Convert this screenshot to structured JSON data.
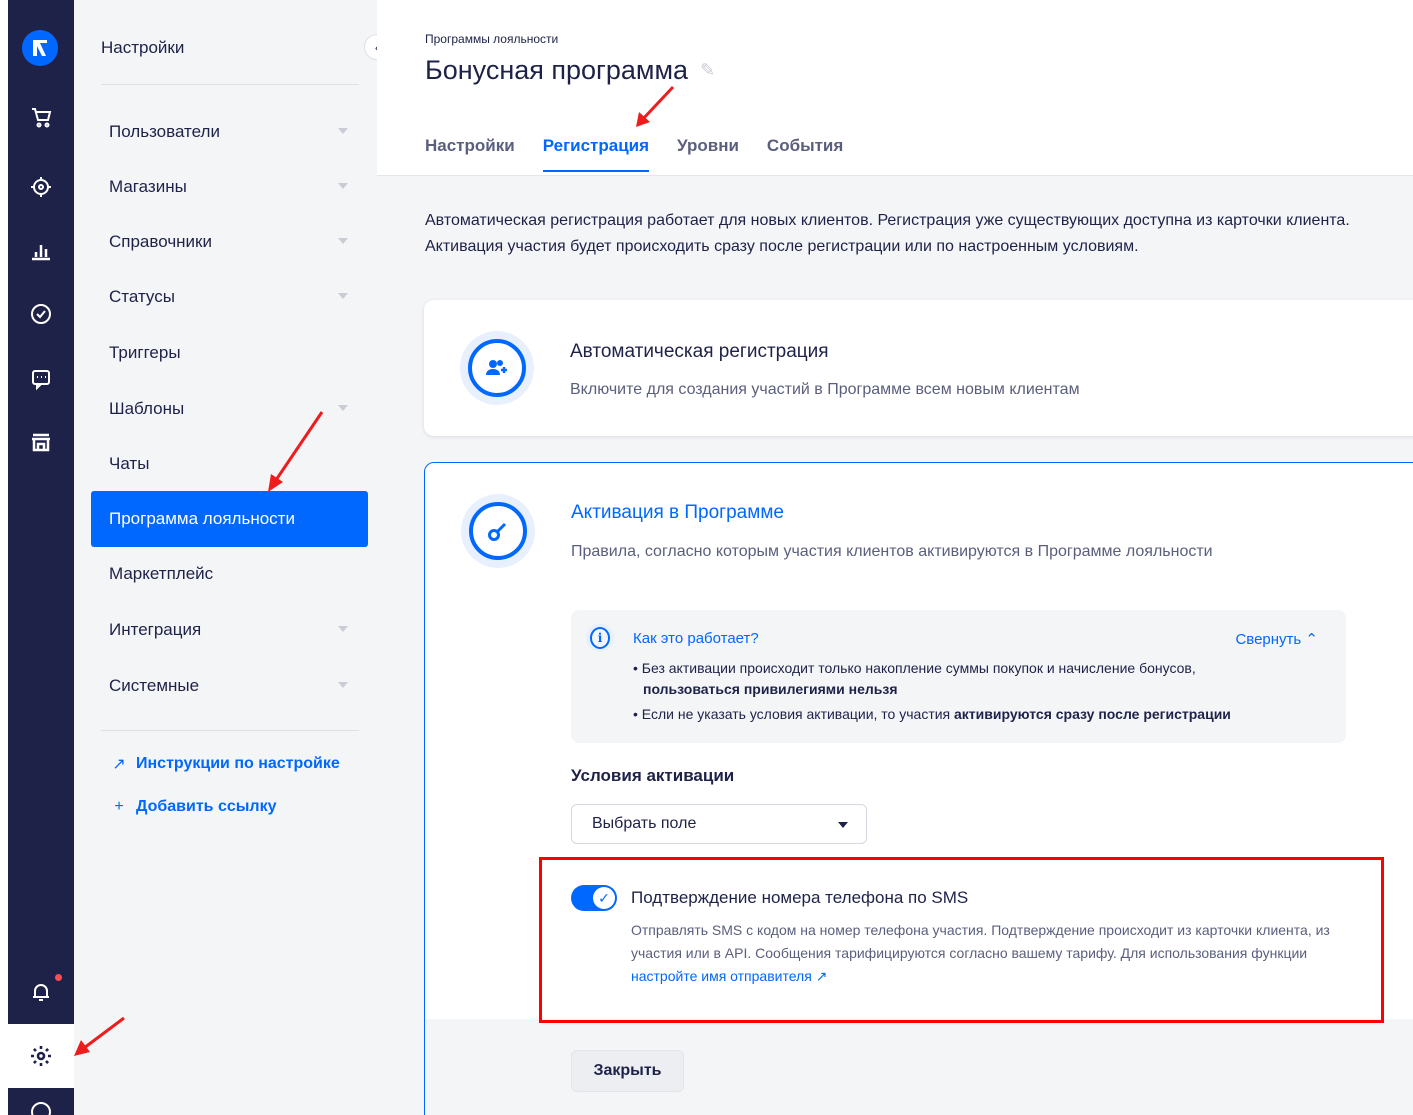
{
  "sidebar": {
    "title": "Настройки",
    "items": [
      {
        "label": "Пользователи",
        "caret": true
      },
      {
        "label": "Магазины",
        "caret": true
      },
      {
        "label": "Справочники",
        "caret": true
      },
      {
        "label": "Статусы",
        "caret": true
      },
      {
        "label": "Триггеры",
        "caret": false
      },
      {
        "label": "Шаблоны",
        "caret": true
      },
      {
        "label": "Чаты",
        "caret": false
      },
      {
        "label": "Программа лояльности",
        "caret": false,
        "active": true
      },
      {
        "label": "Маркетплейс",
        "caret": false
      },
      {
        "label": "Интеграция",
        "caret": true
      },
      {
        "label": "Системные",
        "caret": true
      }
    ],
    "links": [
      {
        "symbol": "↗",
        "label": "Инструкции по настройке"
      },
      {
        "symbol": "+",
        "label": "Добавить ссылку"
      }
    ],
    "collapse_symbol": "‹"
  },
  "header": {
    "breadcrumb": "Программы лояльности",
    "title": "Бонусная программа",
    "edit_symbol": "✎",
    "tabs": [
      {
        "label": "Настройки",
        "active": false
      },
      {
        "label": "Регистрация",
        "active": true
      },
      {
        "label": "Уровни",
        "active": false
      },
      {
        "label": "События",
        "active": false
      }
    ]
  },
  "intro": "Автоматическая регистрация работает для новых клиентов. Регистрация уже существующих доступна из карточки клиента. Активация участия будет происходить сразу после регистрации или по настроенным условиям.",
  "auto_registration": {
    "title": "Автоматическая регистрация",
    "description": "Включите для создания участий в Программе всем новым клиентам",
    "icon": "add-users-icon"
  },
  "activation": {
    "title": "Активация в Программе",
    "description": "Правила, согласно которым участия клиентов активируются в Программе лояльности",
    "icon": "key-icon",
    "info": {
      "title": "Как это работает?",
      "collapse_label": "Свернуть",
      "line1_a": "• Без активации происходит только накопление суммы покупок и начисление бонусов,",
      "line1_b": "пользоваться привилегиями нельзя",
      "line2_a": "• Если не указать условия активации, то участия ",
      "line2_b": "активируются сразу после регистрации"
    },
    "conditions_label": "Условия активации",
    "select_value": "Выбрать поле",
    "sms_toggle": {
      "enabled": true,
      "title": "Подтверждение номера телефона по SMS",
      "description": "Отправлять SMS с кодом на номер телефона участия. Подтверждение происходит из карточки клиента, из участия или в API. Сообщения тарифицируются согласно вашему тарифу. Для использования функции ",
      "link": "настройте имя отправителя ↗"
    },
    "close_label": "Закрыть"
  },
  "colors": {
    "accent": "#0068ff",
    "rail": "#1e2248",
    "annotation": "#ff0000"
  }
}
